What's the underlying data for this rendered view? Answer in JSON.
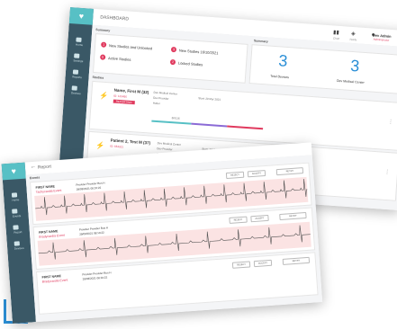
{
  "colors": {
    "accent": "#2b8fd6",
    "brand_teal": "#57c0c5",
    "sidebar": "#3a5866",
    "alert": "#e03a5e"
  },
  "dashboard": {
    "breadcrumb": "DASHBOARD",
    "nav": [
      "Home",
      "Settings",
      "Reports",
      "Devices"
    ],
    "header": {
      "icon_labels": [
        "Chart",
        "Notify"
      ],
      "user_name": "Dev Admin",
      "user_role": "Administrator"
    },
    "todo_title": "Summary",
    "todos": [
      {
        "count": "1",
        "label": "New Studies and Unlocked"
      },
      {
        "count": "0",
        "label": "Active Studies"
      },
      {
        "count": "3",
        "label": "New Studies 16/10/2021"
      },
      {
        "count": "2",
        "label": "Locked Studies"
      }
    ],
    "stats_title": "Summary",
    "stats": [
      {
        "value": "3",
        "label": "Total Devices"
      },
      {
        "value": "3",
        "label": "Dev Medical Center"
      }
    ],
    "studies_title": "Studies",
    "patients": [
      {
        "name": "Name, First M (32)",
        "id": "ID: 123456",
        "status": "REPORTING",
        "site": "Dev Medical Center",
        "provider": "Dev Provider",
        "type": "Holter",
        "start": "Start: 29 Mar 2021",
        "progress": "60/116"
      },
      {
        "name": "Patient 2, Test M (37)",
        "id": "ID: 654321",
        "status": "",
        "site": "Dev Medical Center",
        "provider": "Dev Provider",
        "type": "Holter",
        "start": "Start: 29 Mar 2021",
        "progress": ""
      }
    ]
  },
  "viewer": {
    "title": "Report",
    "nav": [
      "Home",
      "Events",
      "Report",
      "Devices"
    ],
    "section": "Events",
    "buttons": [
      "REJECT",
      "ACCEPT",
      "RETRY"
    ],
    "events": [
      {
        "name": "FIRST NAME",
        "type": "Tachycardia Event",
        "provider": "Provider Provider Bus H",
        "time": "29/03/2021 08:10:22"
      },
      {
        "name": "FIRST NAME",
        "type": "Bradycardia Event",
        "provider": "Provider Provider Bus H",
        "time": "29/03/2021 08:10:22"
      },
      {
        "name": "FIRST NAME",
        "type": "Bradycardia Event",
        "provider": "Provider Provider Bus H",
        "time": "29/03/2021 08:10:22"
      }
    ]
  }
}
